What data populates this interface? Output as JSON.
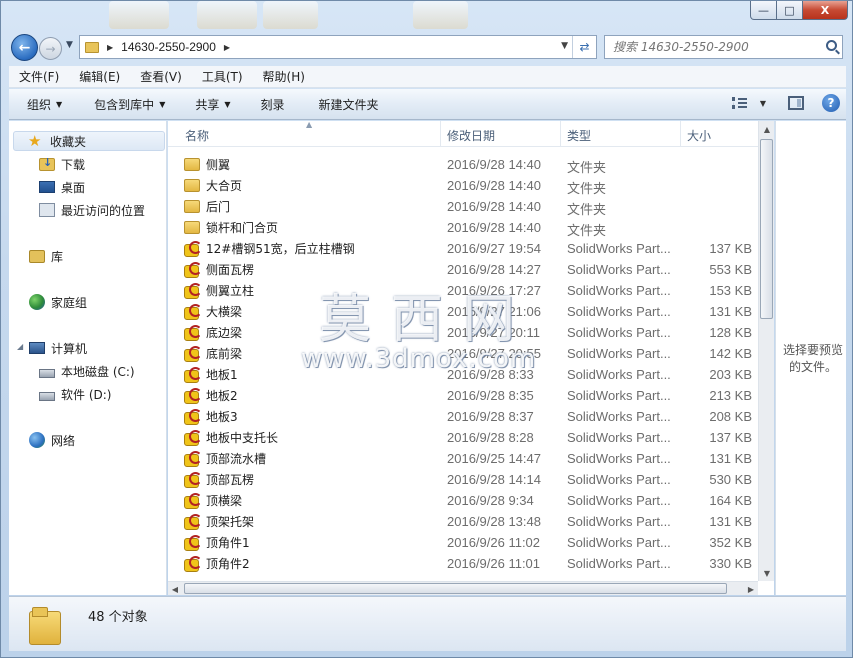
{
  "window": {
    "controls": {
      "minimize": "—",
      "maximize": "□",
      "close": "X"
    }
  },
  "nav": {
    "back": "←",
    "forward": "→",
    "path_segment": "14630-2550-2900",
    "search_placeholder": "搜索 14630-2550-2900"
  },
  "menubar": [
    {
      "label": "文件(F)"
    },
    {
      "label": "编辑(E)"
    },
    {
      "label": "查看(V)"
    },
    {
      "label": "工具(T)"
    },
    {
      "label": "帮助(H)"
    }
  ],
  "toolbar": {
    "organize": "组织",
    "include_in_library": "包含到库中",
    "share": "共享",
    "burn": "刻录",
    "new_folder": "新建文件夹"
  },
  "navpane": {
    "favorites": "收藏夹",
    "downloads": "下载",
    "desktop": "桌面",
    "recent": "最近访问的位置",
    "libraries": "库",
    "homegroup": "家庭组",
    "computer": "计算机",
    "local_disk": "本地磁盘 (C:)",
    "software_disk": "软件 (D:)",
    "network": "网络"
  },
  "columns": {
    "name": "名称",
    "date": "修改日期",
    "type": "类型",
    "size": "大小"
  },
  "files": [
    {
      "name": "侧翼",
      "date": "2016/9/28 14:40",
      "type": "文件夹",
      "size": "",
      "kind": "folder"
    },
    {
      "name": "大合页",
      "date": "2016/9/28 14:40",
      "type": "文件夹",
      "size": "",
      "kind": "folder"
    },
    {
      "name": "后门",
      "date": "2016/9/28 14:40",
      "type": "文件夹",
      "size": "",
      "kind": "folder"
    },
    {
      "name": "锁杆和门合页",
      "date": "2016/9/28 14:40",
      "type": "文件夹",
      "size": "",
      "kind": "folder"
    },
    {
      "name": "12#槽钢51宽，后立柱槽钢",
      "date": "2016/9/27 19:54",
      "type": "SolidWorks Part...",
      "size": "137 KB",
      "kind": "sw"
    },
    {
      "name": "侧面瓦楞",
      "date": "2016/9/28 14:27",
      "type": "SolidWorks Part...",
      "size": "553 KB",
      "kind": "sw"
    },
    {
      "name": "侧翼立柱",
      "date": "2016/9/26 17:27",
      "type": "SolidWorks Part...",
      "size": "153 KB",
      "kind": "sw"
    },
    {
      "name": "大横梁",
      "date": "2016/9/27 21:06",
      "type": "SolidWorks Part...",
      "size": "131 KB",
      "kind": "sw"
    },
    {
      "name": "底边梁",
      "date": "2016/9/27 20:11",
      "type": "SolidWorks Part...",
      "size": "128 KB",
      "kind": "sw"
    },
    {
      "name": "底前梁",
      "date": "2016/9/27 20:55",
      "type": "SolidWorks Part...",
      "size": "142 KB",
      "kind": "sw"
    },
    {
      "name": "地板1",
      "date": "2016/9/28 8:33",
      "type": "SolidWorks Part...",
      "size": "203 KB",
      "kind": "sw"
    },
    {
      "name": "地板2",
      "date": "2016/9/28 8:35",
      "type": "SolidWorks Part...",
      "size": "213 KB",
      "kind": "sw"
    },
    {
      "name": "地板3",
      "date": "2016/9/28 8:37",
      "type": "SolidWorks Part...",
      "size": "208 KB",
      "kind": "sw"
    },
    {
      "name": "地板中支托长",
      "date": "2016/9/28 8:28",
      "type": "SolidWorks Part...",
      "size": "137 KB",
      "kind": "sw"
    },
    {
      "name": "顶部流水槽",
      "date": "2016/9/25 14:47",
      "type": "SolidWorks Part...",
      "size": "131 KB",
      "kind": "sw"
    },
    {
      "name": "顶部瓦楞",
      "date": "2016/9/28 14:14",
      "type": "SolidWorks Part...",
      "size": "530 KB",
      "kind": "sw"
    },
    {
      "name": "顶横梁",
      "date": "2016/9/28 9:34",
      "type": "SolidWorks Part...",
      "size": "164 KB",
      "kind": "sw"
    },
    {
      "name": "顶架托架",
      "date": "2016/9/28 13:48",
      "type": "SolidWorks Part...",
      "size": "131 KB",
      "kind": "sw"
    },
    {
      "name": "顶角件1",
      "date": "2016/9/26 11:02",
      "type": "SolidWorks Part...",
      "size": "352 KB",
      "kind": "sw"
    },
    {
      "name": "顶角件2",
      "date": "2016/9/26 11:01",
      "type": "SolidWorks Part...",
      "size": "330 KB",
      "kind": "sw"
    }
  ],
  "preview": {
    "text": "选择要预览的文件。"
  },
  "watermark": {
    "big": "莫西网",
    "small": "www.3dmox.com"
  },
  "status": {
    "count": "48 个对象"
  }
}
